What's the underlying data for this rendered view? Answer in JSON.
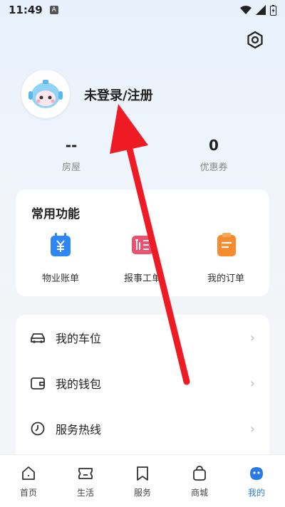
{
  "status_bar": {
    "time": "11:49",
    "badge": "A"
  },
  "profile": {
    "login_label": "未登录/注册"
  },
  "stats": [
    {
      "value": "--",
      "label": "房屋"
    },
    {
      "value": "0",
      "label": "优惠券"
    }
  ],
  "functions": {
    "title": "常用功能",
    "items": [
      {
        "label": "物业账单",
        "icon": "bill-icon",
        "color": "#2f86f6"
      },
      {
        "label": "报事工单",
        "icon": "tool-icon",
        "color": "#f0506e"
      },
      {
        "label": "我的订单",
        "icon": "order-icon",
        "color": "#f78b2f"
      }
    ]
  },
  "menu": [
    {
      "label": "我的车位",
      "icon": "car-icon"
    },
    {
      "label": "我的钱包",
      "icon": "wallet-icon"
    },
    {
      "label": "服务热线",
      "icon": "clock-icon"
    }
  ],
  "tabs": [
    {
      "label": "首页",
      "icon": "home-icon"
    },
    {
      "label": "生活",
      "icon": "ticket-icon"
    },
    {
      "label": "服务",
      "icon": "bookmark-icon"
    },
    {
      "label": "商城",
      "icon": "bag-icon"
    },
    {
      "label": "我的",
      "icon": "profile-icon",
      "active": true
    }
  ],
  "colors": {
    "accent": "#2a7ae4",
    "annotation_arrow": "#ee1b24"
  }
}
